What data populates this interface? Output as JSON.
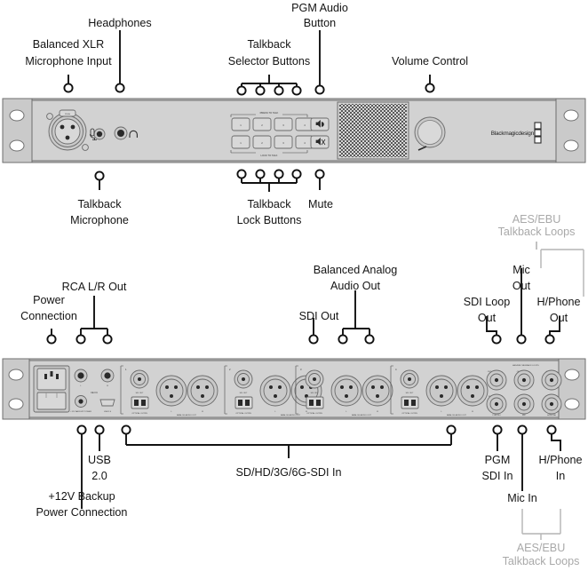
{
  "document": {
    "title": "Blackmagic Design audio device — front and rear panel connection diagram",
    "background_color": "#ffffff",
    "chassis_color": "#d2d2d2",
    "callout_color": "#141414",
    "dim_callout_color": "#a9a9a9"
  },
  "front_panel": {
    "name": "Front panel",
    "callouts_top": [
      {
        "id": "balanced-xlr-microphone-input",
        "lines": [
          "Balanced XLR",
          "Microphone Input"
        ]
      },
      {
        "id": "headphones",
        "lines": [
          "Headphones"
        ]
      },
      {
        "id": "talkback-selector-buttons",
        "lines": [
          "Talkback",
          "Selector Buttons"
        ]
      },
      {
        "id": "pgm-audio-button",
        "lines": [
          "PGM Audio",
          "Button"
        ]
      },
      {
        "id": "volume-control",
        "lines": [
          "Volume Control"
        ]
      }
    ],
    "callouts_bottom": [
      {
        "id": "talkback-microphone",
        "lines": [
          "Talkback",
          "Microphone"
        ]
      },
      {
        "id": "talkback-lock-buttons",
        "lines": [
          "Talkback",
          "Lock Buttons"
        ]
      },
      {
        "id": "mute",
        "lines": [
          "Mute"
        ]
      }
    ],
    "device_markings": {
      "xlr_push_tab": "PUSH",
      "press_to_talk": "PRESS TO TALK",
      "lock_to_talk": "LOCK TO TALK",
      "press_row_numbers": [
        "1",
        "2",
        "3",
        "4"
      ],
      "lock_row_numbers": [
        "1",
        "2",
        "3",
        "4"
      ],
      "brand": "Blackmagicdesign"
    }
  },
  "rear_panel": {
    "name": "Rear panel",
    "callouts_top": [
      {
        "id": "power-connection",
        "lines": [
          "Power",
          "Connection"
        ]
      },
      {
        "id": "rca-lr-out",
        "lines": [
          "RCA L/R Out"
        ]
      },
      {
        "id": "sdi-out",
        "lines": [
          "SDI Out"
        ]
      },
      {
        "id": "balanced-analog-audio-out",
        "lines": [
          "Balanced Analog",
          "Audio Out"
        ]
      },
      {
        "id": "sdi-loop-out",
        "lines": [
          "SDI Loop",
          "Out"
        ]
      },
      {
        "id": "mic-out",
        "lines": [
          "Mic",
          "Out"
        ]
      },
      {
        "id": "hphone-out",
        "lines": [
          "H/Phone",
          "Out"
        ]
      }
    ],
    "callouts_bottom": [
      {
        "id": "plus-12v-backup-power-connection",
        "lines": [
          "+12V Backup",
          "Power Connection"
        ]
      },
      {
        "id": "usb-2-0",
        "lines": [
          "USB",
          "2.0"
        ]
      },
      {
        "id": "sd-hd-3g-6g-sdi-in",
        "lines": [
          "SD/HD/3G/6G-SDI In"
        ]
      },
      {
        "id": "pgm-sdi-in",
        "lines": [
          "PGM",
          "SDI In"
        ]
      },
      {
        "id": "mic-in",
        "lines": [
          "Mic In"
        ]
      },
      {
        "id": "hphone-in",
        "lines": [
          "H/Phone",
          "In"
        ]
      }
    ],
    "dim_callouts": [
      {
        "id": "aes-ebu-talkback-loops-top",
        "lines": [
          "AES/EBU",
          "Talkback Loops"
        ]
      },
      {
        "id": "aes-ebu-talkback-loops-bottom",
        "lines": [
          "AES/EBU",
          "Talkback Loops"
        ]
      }
    ],
    "device_markings": {
      "channel_numbers": [
        "1",
        "2",
        "3",
        "4"
      ],
      "sdi_out": "SDI OUT",
      "optical_out_in": "OPTICAL OUT/IN",
      "analog_audio_out": "ANALOG AUDIO OUT",
      "xlr_left": "L",
      "xlr_right": "R",
      "backup_power": "+12V BACKUP POWER",
      "usb": "USB 2.0",
      "cert_marks": "CE FC",
      "aes_group": "AES/EBU TALKBACK LOOPS",
      "out_label": "OUT",
      "in_label": "IN",
      "bnc_groups": [
        "PGM SDI",
        "MIC",
        "H/PHONE"
      ]
    }
  }
}
